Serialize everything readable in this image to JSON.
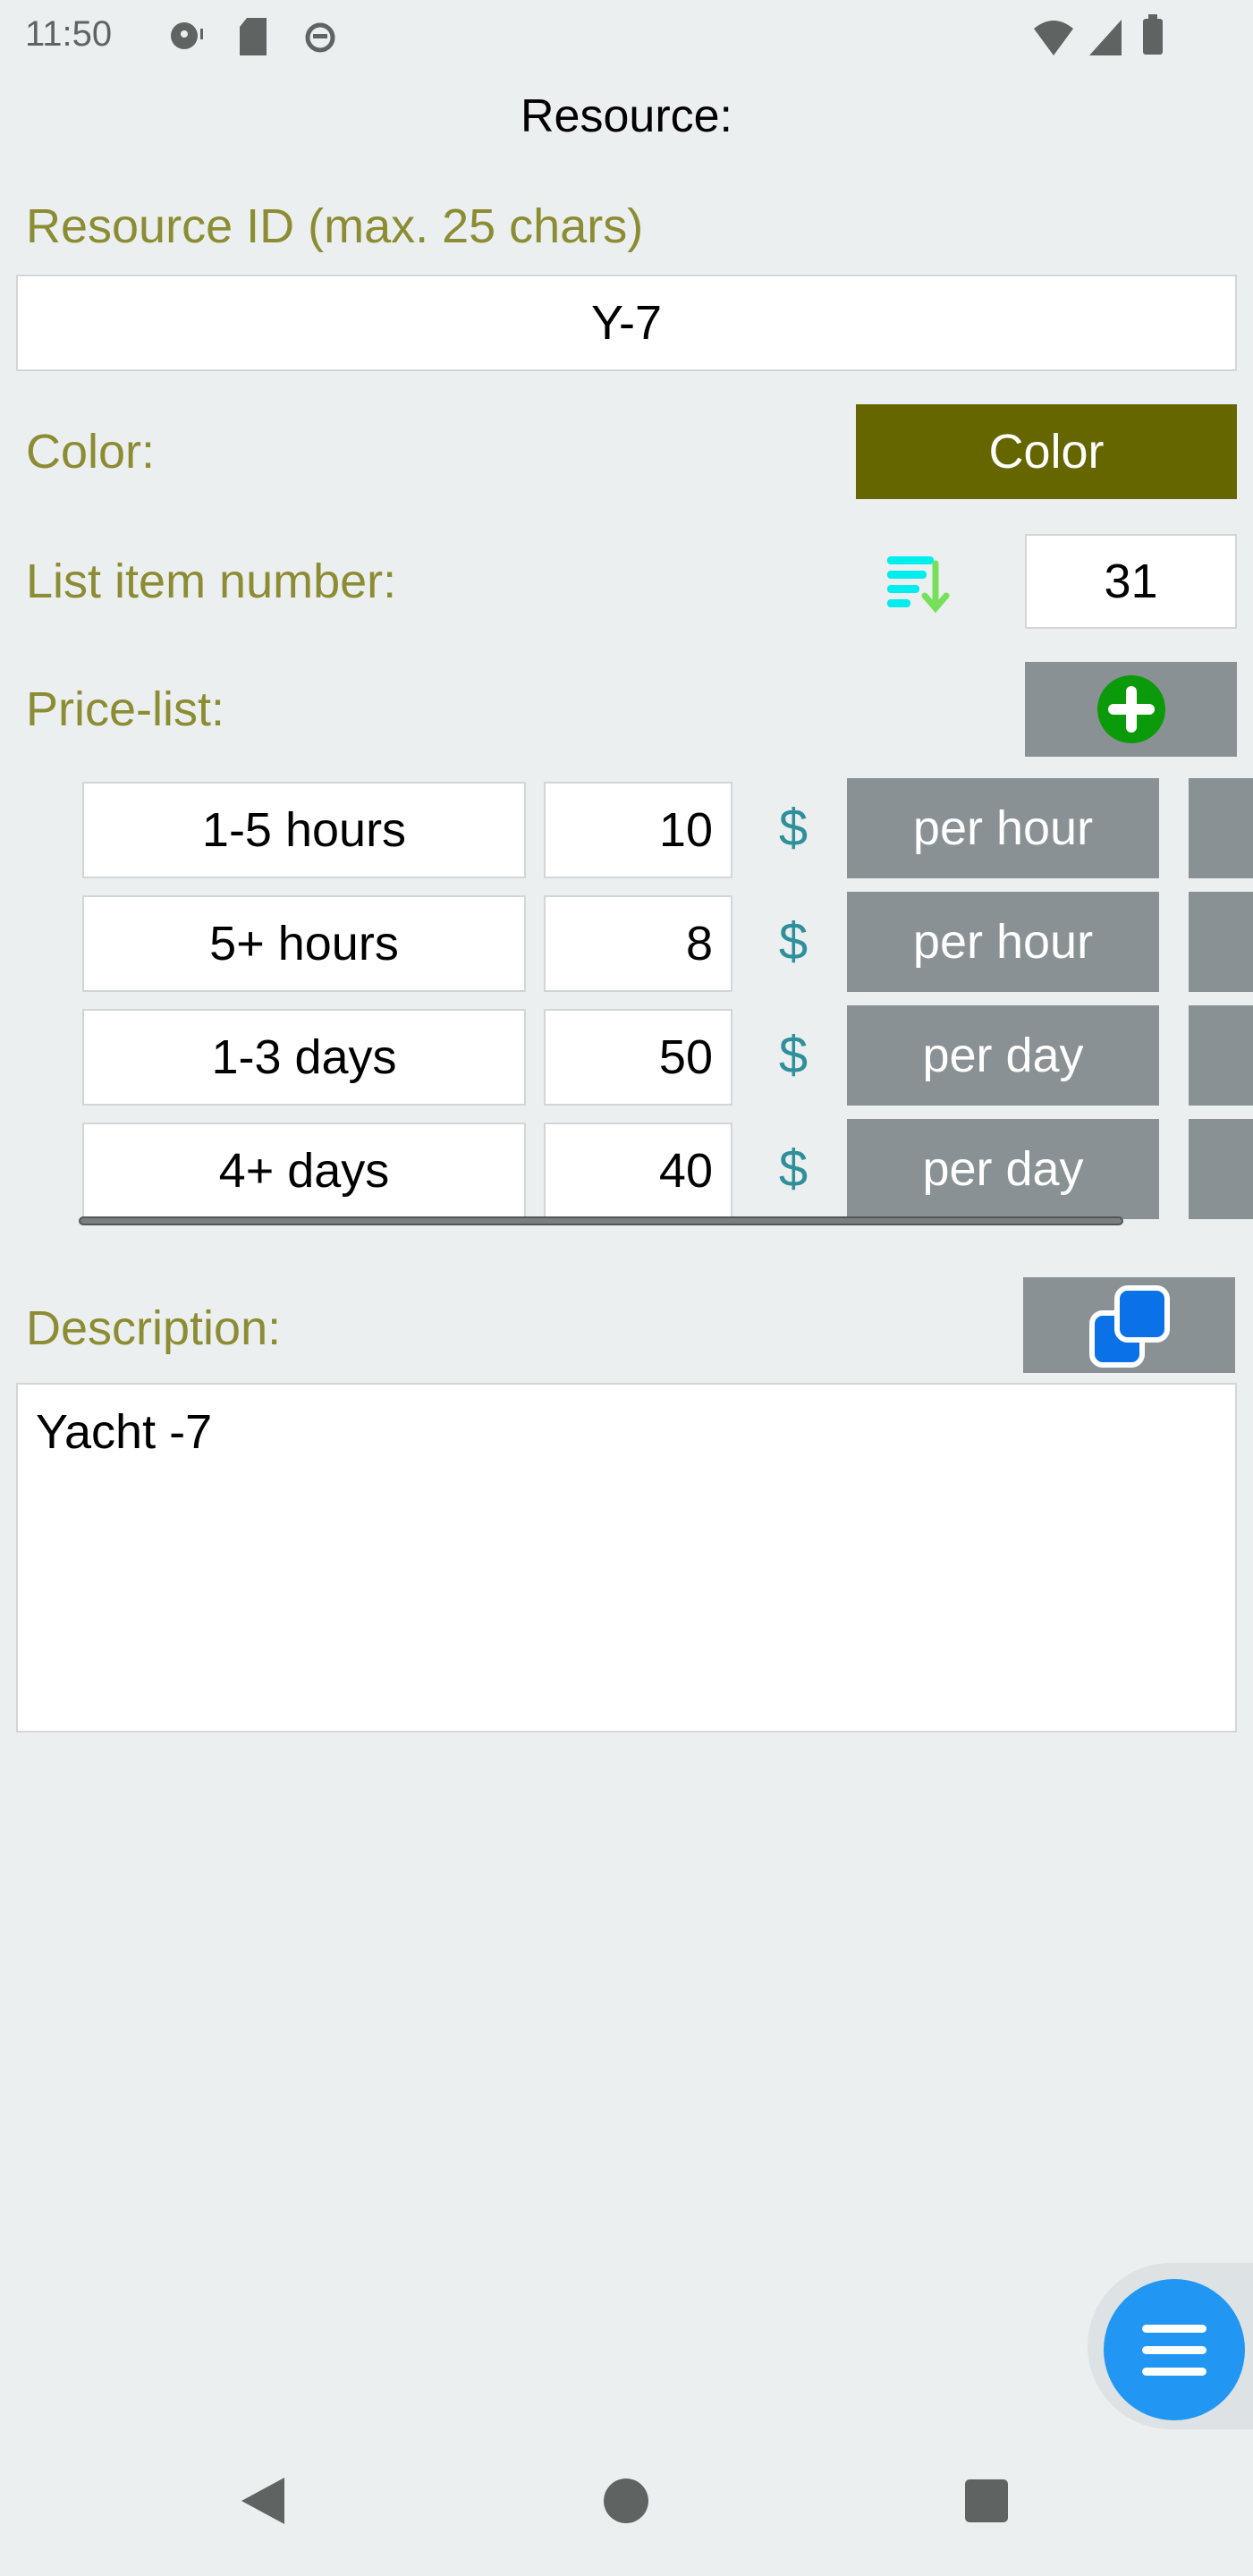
{
  "status_bar": {
    "time": "11:50"
  },
  "header": {
    "title": "Resource:"
  },
  "resource_id": {
    "label": "Resource ID (max. 25 chars)",
    "value": "Y-7"
  },
  "color": {
    "label": "Color:",
    "button_label": "Color",
    "value": "#666600"
  },
  "list_item": {
    "label": "List item number:",
    "value": "31"
  },
  "price_list": {
    "label": "Price-list:",
    "currency": "$",
    "rows": [
      {
        "name": "1-5 hours",
        "price": "10",
        "unit": "per hour"
      },
      {
        "name": "5+ hours",
        "price": "8",
        "unit": "per hour"
      },
      {
        "name": "1-3 days",
        "price": "50",
        "unit": "per day"
      },
      {
        "name": "4+ days",
        "price": "40",
        "unit": "per day"
      }
    ]
  },
  "description": {
    "label": "Description:",
    "value": "Yacht -7"
  },
  "colors": {
    "label": "#8c8c32",
    "button": "#8a9194",
    "fab": "#2196f3"
  }
}
